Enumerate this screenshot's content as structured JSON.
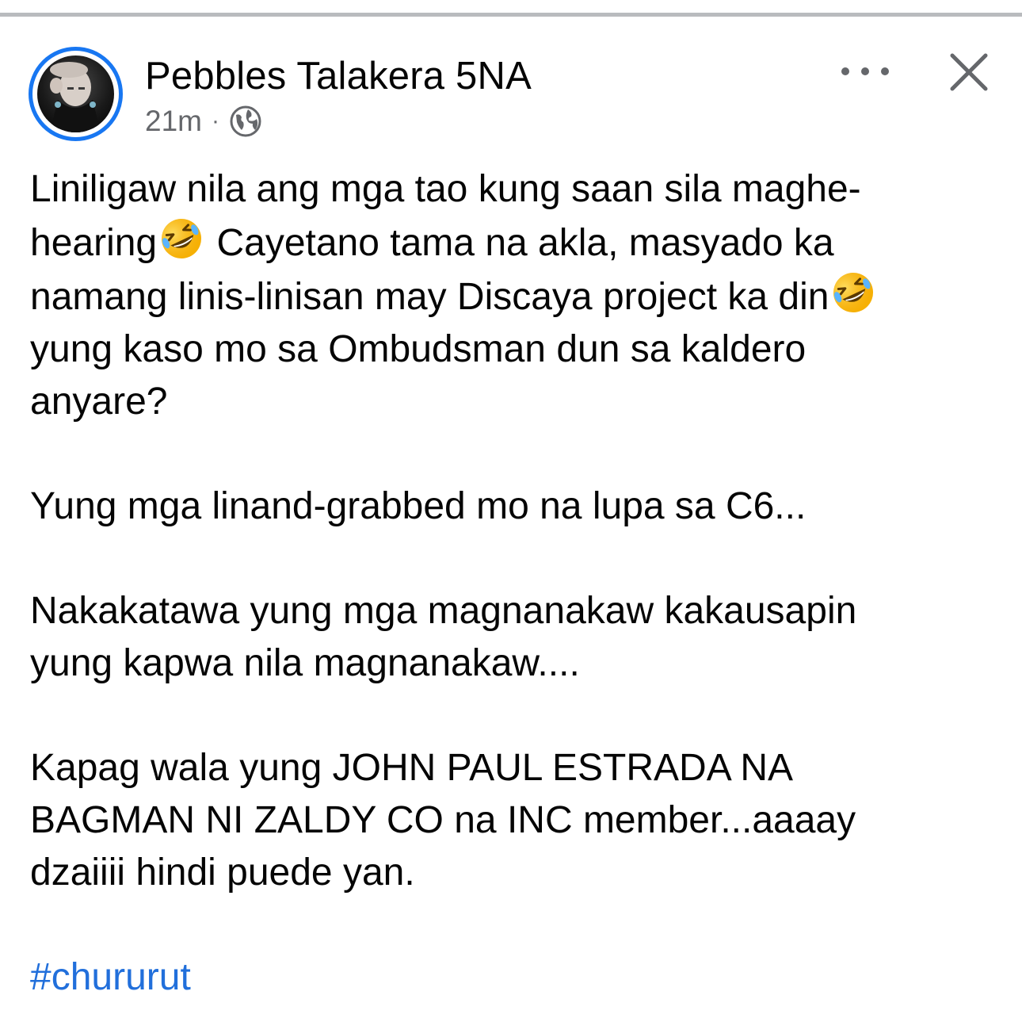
{
  "post": {
    "author": "Pebbles Talakera 5NA",
    "time": "21m",
    "separator": "·",
    "privacy_icon": "globe-icon",
    "more_icon": "more-options-icon",
    "close_icon": "close-icon",
    "paragraph1": {
      "line1": "Liniligaw nila ang mga tao kung saan sila maghe-",
      "line2a": "hearing",
      "line2b": " Cayetano tama na akla, masyado ka",
      "line3": "namang linis-linisan may Discaya project ka din",
      "line4": "yung kaso mo sa Ombudsman dun sa kaldero",
      "line5": "anyare?"
    },
    "paragraph2": "Yung mga linand-grabbed mo na lupa sa C6...",
    "paragraph3": {
      "line1": "Nakakatawa yung mga magnanakaw kakausapin",
      "line2": "yung kapwa nila magnanakaw...."
    },
    "paragraph4": {
      "line1": "Kapag wala yung JOHN PAUL ESTRADA NA",
      "line2": "BAGMAN NI ZALDY CO na INC member...aaaay",
      "line3": "dzaiiii hindi puede yan."
    },
    "hashtag": "#chururut",
    "emoji": "rolling-on-the-floor-laughing"
  },
  "colors": {
    "avatar_ring": "#1877f2",
    "hashtag": "#216fdb",
    "meta_text": "#65676b"
  }
}
